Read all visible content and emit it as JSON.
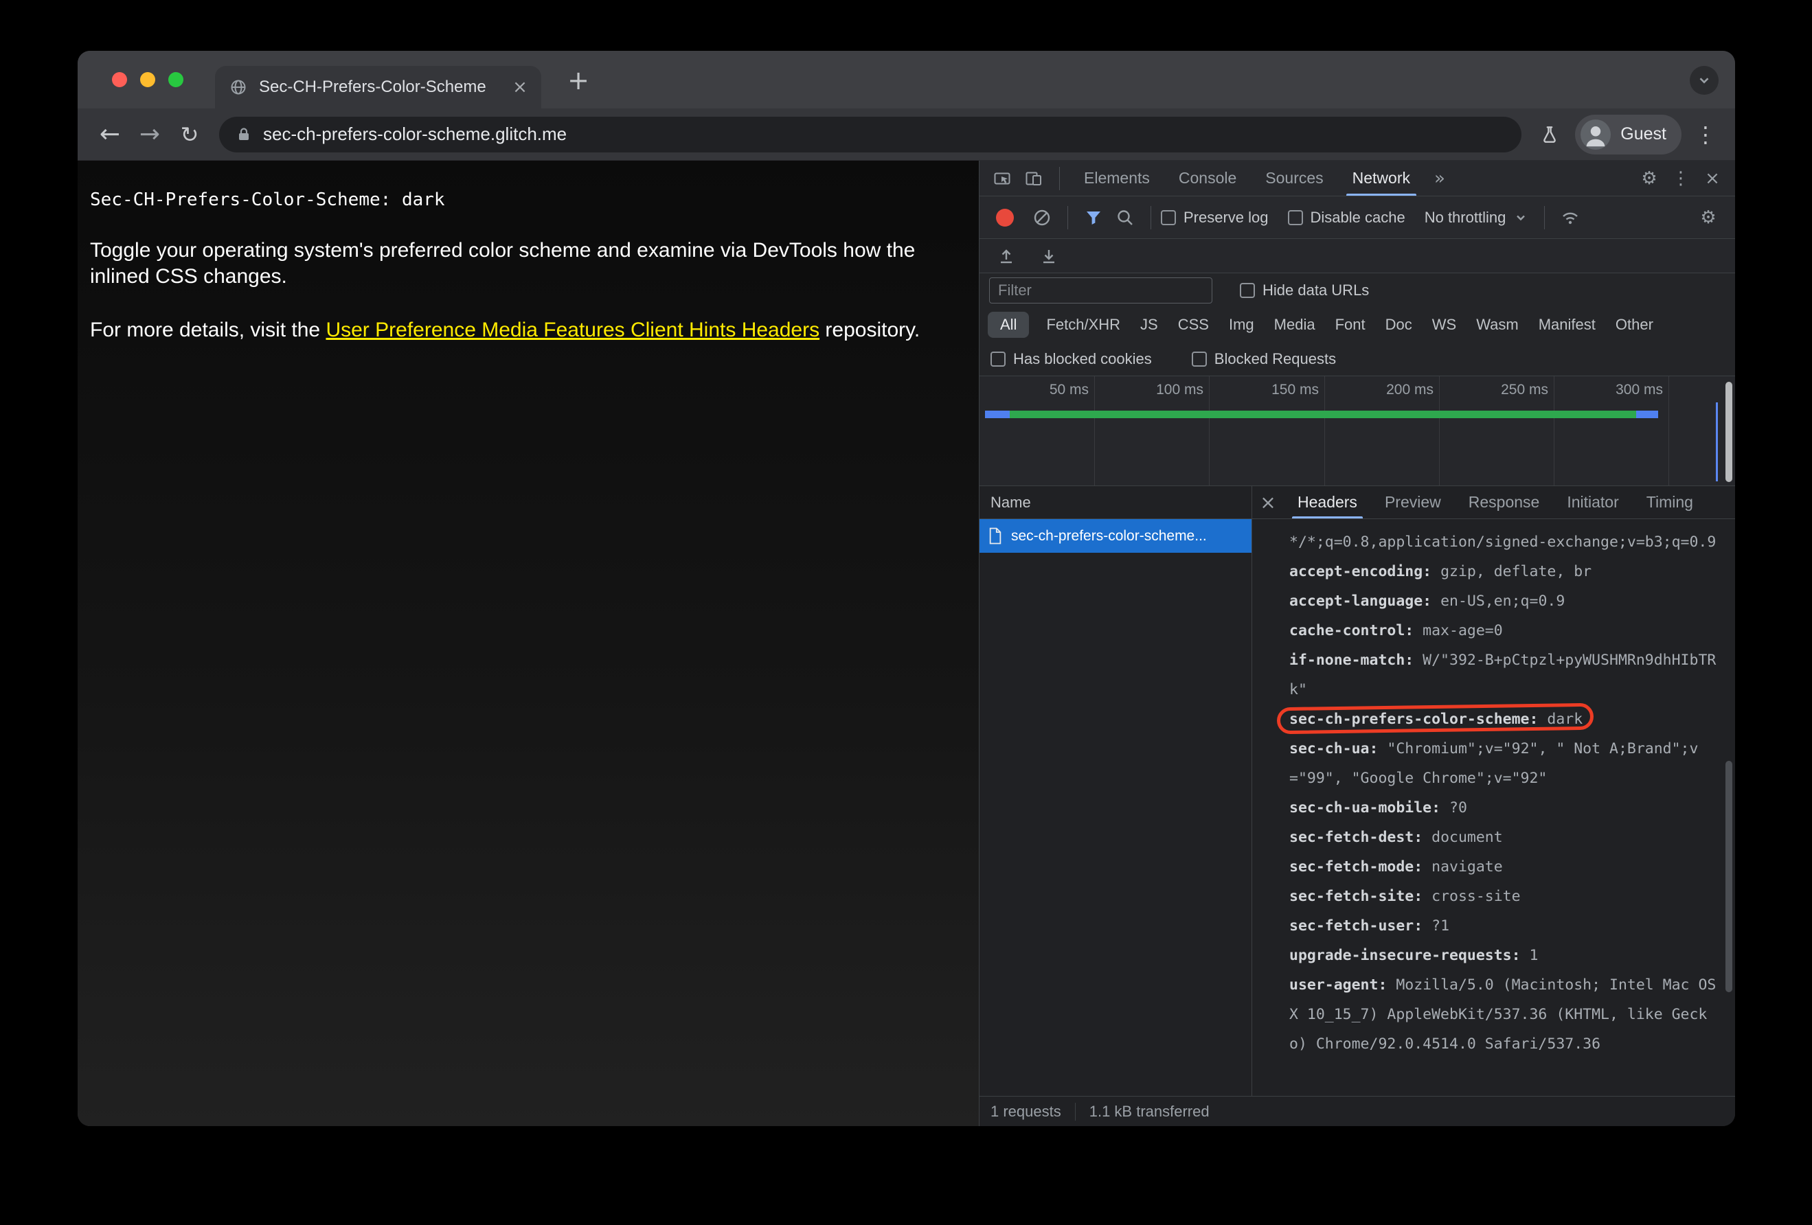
{
  "window": {
    "tab": {
      "title": "Sec-CH-Prefers-Color-Scheme"
    },
    "address": {
      "url": "sec-ch-prefers-color-scheme.glitch.me"
    },
    "profile": {
      "label": "Guest"
    }
  },
  "icons": {
    "back": "←",
    "forward": "→",
    "reload": "↻",
    "new_tab": "+",
    "tab_close": "×",
    "menu_dots": "⋮",
    "more_tabs": "»",
    "gear": "⚙",
    "close": "×",
    "detail_close": "×"
  },
  "page": {
    "header_line": "Sec-CH-Prefers-Color-Scheme: dark",
    "paragraph1": "Toggle your operating system's preferred color scheme and examine via DevTools how the inlined CSS changes.",
    "paragraph2_prefix": "For more details, visit the ",
    "paragraph2_link": "User Preference Media Features Client Hints Headers",
    "paragraph2_suffix": " repository."
  },
  "devtools": {
    "panel_tabs": [
      "Elements",
      "Console",
      "Sources",
      "Network"
    ],
    "active_panel": "Network",
    "network_toolbar": {
      "preserve_log": "Preserve log",
      "disable_cache": "Disable cache",
      "throttling": "No throttling"
    },
    "filter_bar": {
      "placeholder": "Filter",
      "hide_data_urls": "Hide data URLs"
    },
    "type_chips": [
      "All",
      "Fetch/XHR",
      "JS",
      "CSS",
      "Img",
      "Media",
      "Font",
      "Doc",
      "WS",
      "Wasm",
      "Manifest",
      "Other"
    ],
    "active_chip": "All",
    "blocked_row": {
      "has_blocked_cookies": "Has blocked cookies",
      "blocked_requests": "Blocked Requests"
    },
    "timeline_ticks": [
      "50 ms",
      "100 ms",
      "150 ms",
      "200 ms",
      "250 ms",
      "300 ms"
    ],
    "requests": {
      "name_header": "Name",
      "rows": [
        {
          "name": "sec-ch-prefers-color-scheme..."
        }
      ]
    },
    "detail_tabs": [
      "Headers",
      "Preview",
      "Response",
      "Initiator",
      "Timing"
    ],
    "active_detail_tab": "Headers",
    "request_headers": [
      {
        "name": "",
        "value": "*/*;q=0.8,application/signed-exchange;v=b3;q=0.9"
      },
      {
        "name": "accept-encoding:",
        "value": "gzip, deflate, br"
      },
      {
        "name": "accept-language:",
        "value": "en-US,en;q=0.9"
      },
      {
        "name": "cache-control:",
        "value": "max-age=0"
      },
      {
        "name": "if-none-match:",
        "value": "W/\"392-B+pCtpzl+pyWUSHMRn9dhHIbTRk\""
      },
      {
        "name": "sec-ch-prefers-color-scheme:",
        "value": "dark"
      },
      {
        "name": "sec-ch-ua:",
        "value": "\"Chromium\";v=\"92\", \" Not A;Brand\";v=\"99\", \"Google Chrome\";v=\"92\""
      },
      {
        "name": "sec-ch-ua-mobile:",
        "value": "?0"
      },
      {
        "name": "sec-fetch-dest:",
        "value": "document"
      },
      {
        "name": "sec-fetch-mode:",
        "value": "navigate"
      },
      {
        "name": "sec-fetch-site:",
        "value": "cross-site"
      },
      {
        "name": "sec-fetch-user:",
        "value": "?1"
      },
      {
        "name": "upgrade-insecure-requests:",
        "value": "1"
      },
      {
        "name": "user-agent:",
        "value": "Mozilla/5.0 (Macintosh; Intel Mac OS X 10_15_7) AppleWebKit/537.36 (KHTML, like Gecko) Chrome/92.0.4514.0 Safari/537.36"
      }
    ],
    "status_bar": {
      "requests": "1 requests",
      "transferred": "1.1 kB transferred"
    }
  }
}
